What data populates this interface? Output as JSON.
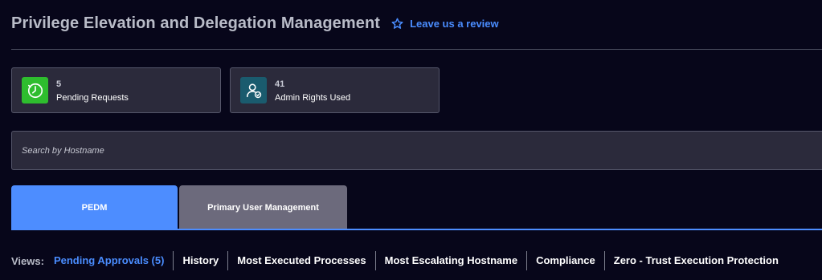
{
  "header": {
    "title": "Privilege Elevation and Delegation Management",
    "review_link": "Leave us a review",
    "review_icon": "star-icon"
  },
  "stats": [
    {
      "value": "5",
      "label": "Pending Requests",
      "icon": "clock-check-icon",
      "color": "#2ebd2e"
    },
    {
      "value": "41",
      "label": "Admin Rights Used",
      "icon": "user-admin-icon",
      "color": "#1a5b6e"
    }
  ],
  "search": {
    "placeholder": "Search by Hostname",
    "value": ""
  },
  "tabs": [
    {
      "label": "PEDM",
      "active": true
    },
    {
      "label": "Primary User Management",
      "active": false
    }
  ],
  "views": {
    "label": "Views:",
    "items": [
      "Pending Approvals (5)",
      "History",
      "Most Executed Processes",
      "Most Escalating Hostname",
      "Compliance",
      "Zero - Trust Execution Protection"
    ]
  },
  "colors": {
    "accent": "#4a8dff",
    "background": "#07061a",
    "card": "#2b2a3b"
  }
}
